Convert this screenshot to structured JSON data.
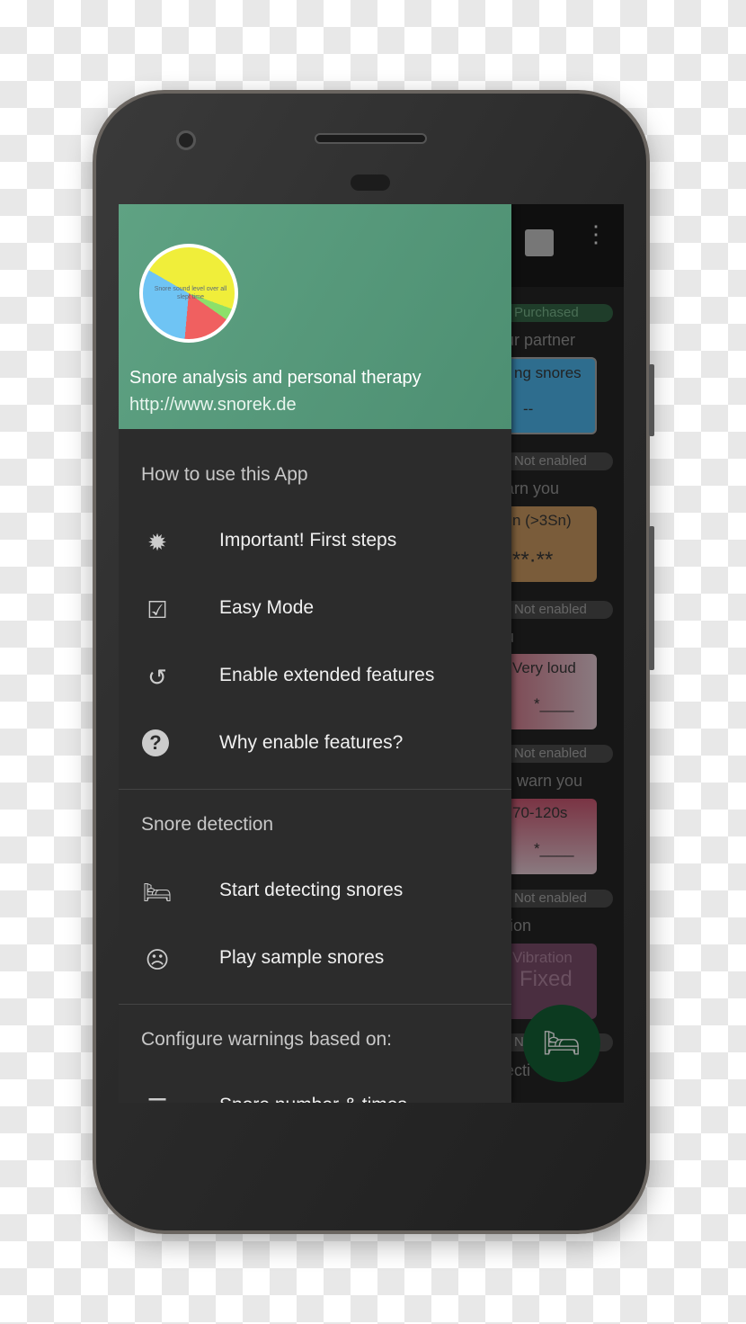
{
  "drawer": {
    "header": {
      "title": "Snore analysis and personal therapy",
      "url": "http://www.snorek.de",
      "pie_caption": "Snore sound level over all slept time"
    },
    "sections": [
      {
        "title": "How to use this App",
        "items": [
          {
            "label": "Important! First steps",
            "icon": "alert-badge-icon"
          },
          {
            "label": "Easy Mode",
            "icon": "checkbox-checked-icon"
          },
          {
            "label": "Enable extended features",
            "icon": "restore-icon"
          },
          {
            "label": "Why enable features?",
            "icon": "help-circle-icon"
          }
        ]
      },
      {
        "title": "Snore detection",
        "items": [
          {
            "label": "Start detecting snores",
            "icon": "bed-icon"
          },
          {
            "label": "Play sample snores",
            "icon": "sleepy-face-icon"
          }
        ]
      },
      {
        "title": "Configure warnings based on:",
        "items": [
          {
            "label": "Snore number & times",
            "icon": "tune-icon"
          }
        ]
      }
    ]
  },
  "background": {
    "toolbar_icons": [
      "feedback-icon",
      "more-vert-icon"
    ],
    "pills": [
      "Purchased",
      "Not enabled",
      "Not enabled",
      "Not enabled",
      "Not enabled",
      "N"
    ],
    "labels": [
      "ur partner",
      "arn you",
      "u",
      "warn you",
      "tion",
      "ecti"
    ],
    "cards": [
      {
        "title": "ng snores",
        "value": "--",
        "color": "#2e6d8e"
      },
      {
        "title": "n (>3Sn)",
        "value": "**·**",
        "color": "#7a5c3a"
      },
      {
        "title": "Very loud",
        "value": "*____",
        "color": "#7a3a46"
      },
      {
        "title": "70-120s",
        "value": "*____",
        "color": "#7a3444"
      },
      {
        "title": "Vibration",
        "value": "Fixed",
        "color": "#4a2e40"
      }
    ],
    "fab_icon": "bed-icon"
  }
}
